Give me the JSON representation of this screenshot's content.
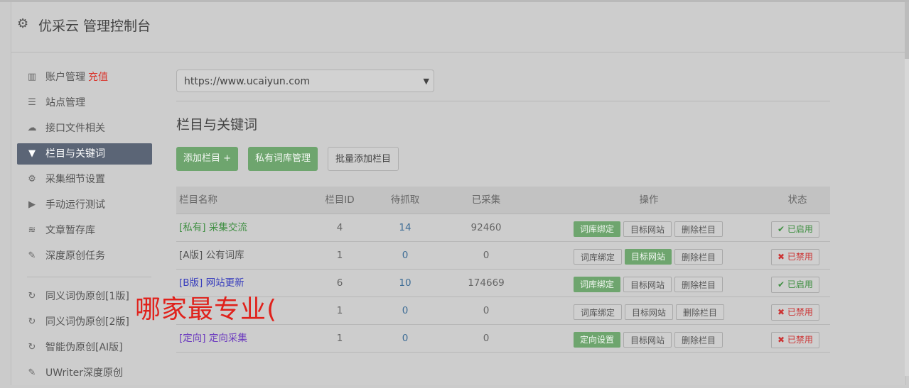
{
  "header": {
    "title": "优采云 管理控制台",
    "icon": "gear-icon"
  },
  "sidebar": {
    "items": [
      {
        "label": "账户管理",
        "extra": "充值",
        "icon": "bar-chart-icon"
      },
      {
        "label": "站点管理",
        "icon": "server-icon"
      },
      {
        "label": "接口文件相关",
        "icon": "cloud-upload-icon"
      },
      {
        "label": "栏目与关键词",
        "icon": "filter-icon",
        "active": true
      },
      {
        "label": "采集细节设置",
        "icon": "gears-icon"
      },
      {
        "label": "手动运行测试",
        "icon": "play-circle-icon"
      },
      {
        "label": "文章暂存库",
        "icon": "database-icon"
      },
      {
        "label": "深度原创任务",
        "icon": "edit-icon"
      }
    ],
    "items2": [
      {
        "label": "同义词伪原创[1版]",
        "icon": "refresh-icon"
      },
      {
        "label": "同义词伪原创[2版]",
        "icon": "refresh-icon"
      },
      {
        "label": "智能伪原创[AI版]",
        "icon": "refresh-icon"
      },
      {
        "label": "UWriter深度原创",
        "icon": "edit-icon"
      }
    ]
  },
  "main": {
    "site_select": "https://www.ucaiyun.com",
    "section_title": "栏目与关键词",
    "toolbar": {
      "add": "添加栏目 +",
      "private_lib": "私有词库管理",
      "batch_add": "批量添加栏目"
    },
    "columns": {
      "name": "栏目名称",
      "id": "栏目ID",
      "pending": "待抓取",
      "done": "已采集",
      "ops": "操作",
      "status": "状态"
    },
    "rows": [
      {
        "tag": "[私有]",
        "name": "采集交流",
        "id": "4",
        "pending": "14",
        "done": "92460",
        "op1": "词库绑定",
        "op2": "目标网站",
        "op3": "删除栏目",
        "status": "已启用"
      },
      {
        "tag": "[A版]",
        "name": "公有词库",
        "id": "1",
        "pending": "0",
        "done": "0",
        "op1": "词库绑定",
        "op2": "目标网站",
        "op3": "删除栏目",
        "status": "已禁用"
      },
      {
        "tag": "[B版]",
        "name": "网站更新",
        "id": "6",
        "pending": "10",
        "done": "174669",
        "op1": "词库绑定",
        "op2": "目标网站",
        "op3": "删除栏目",
        "status": "已启用"
      },
      {
        "tag": "",
        "name": "",
        "id": "1",
        "pending": "0",
        "done": "0",
        "op1": "词库绑定",
        "op2": "目标网站",
        "op3": "删除栏目",
        "status": "已禁用"
      },
      {
        "tag": "[定向]",
        "name": "定向采集",
        "id": "1",
        "pending": "0",
        "done": "0",
        "op1": "定向设置",
        "op2": "目标网站",
        "op3": "删除栏目",
        "status": "已禁用"
      }
    ]
  },
  "overlay": "哪家最专业(",
  "colors": {
    "accent_green": "#6ea56e",
    "active_nav": "#5b6576",
    "overlay_red": "#e0211b"
  }
}
